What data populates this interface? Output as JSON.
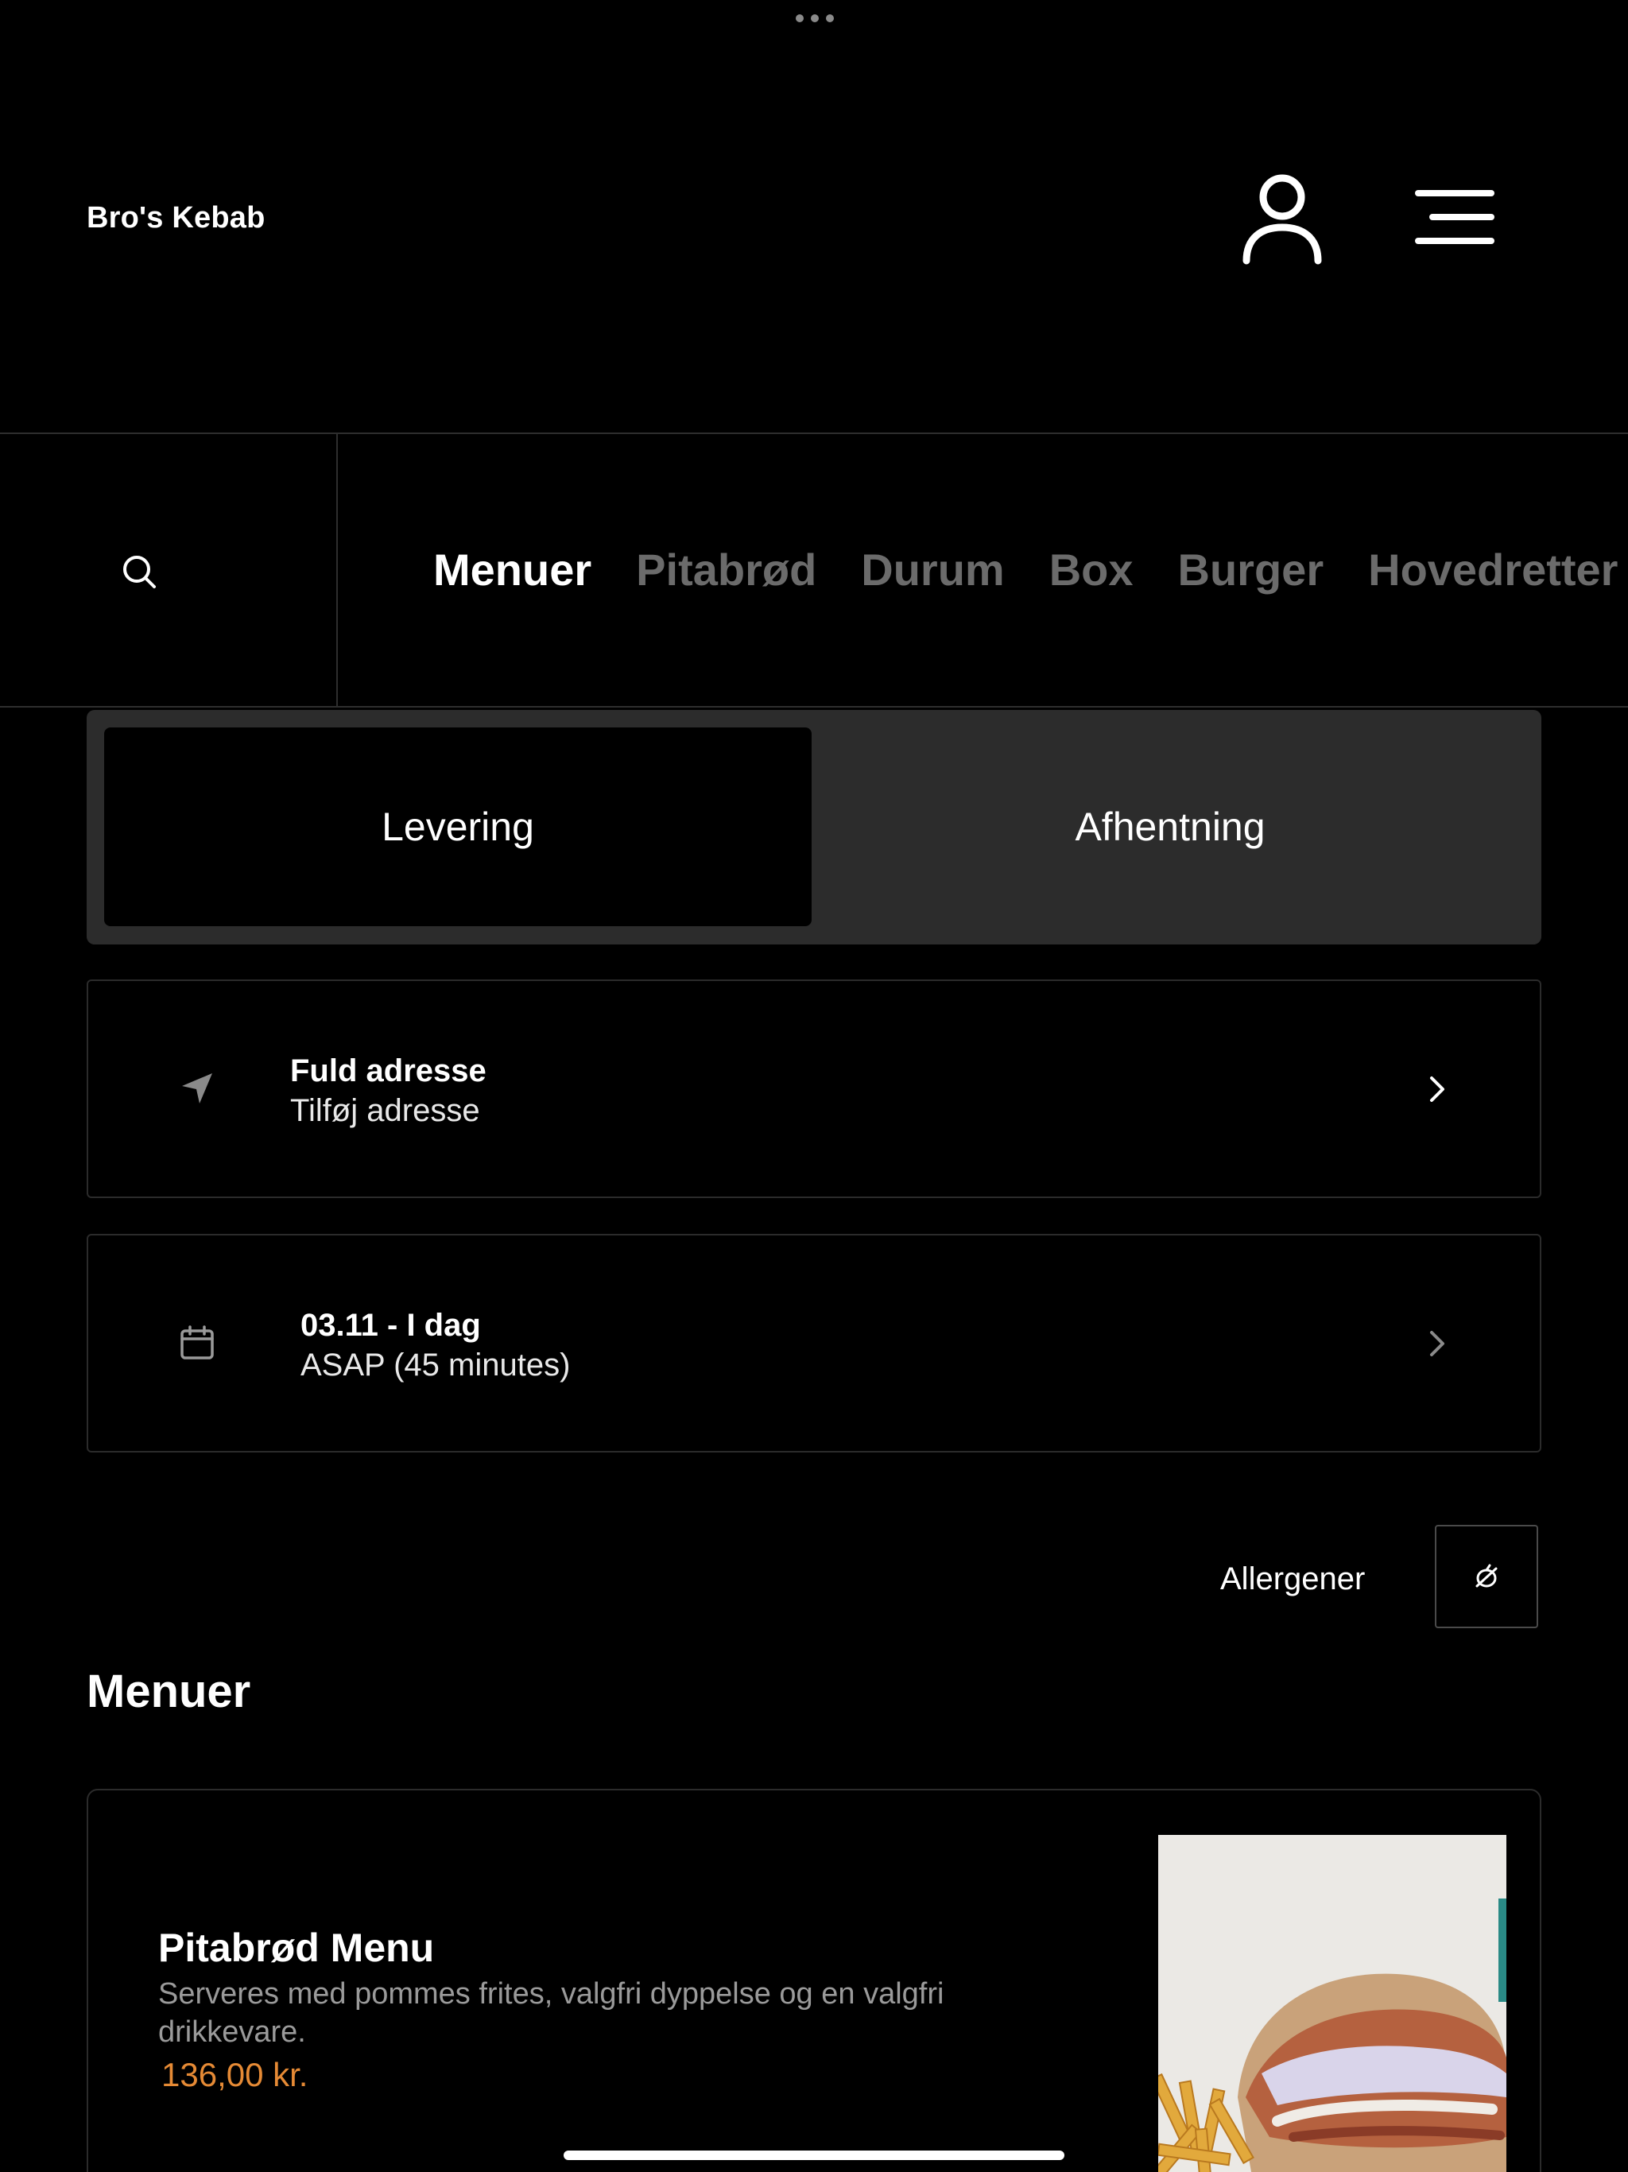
{
  "header": {
    "brand": "Bro's Kebab",
    "account_icon": "user-icon",
    "menu_icon": "hamburger-menu-icon"
  },
  "category_bar": {
    "search_icon": "search-icon",
    "tabs": [
      {
        "label": "Menuer",
        "active": true
      },
      {
        "label": "Pitabrød",
        "active": false
      },
      {
        "label": "Durum",
        "active": false
      },
      {
        "label": "Box",
        "active": false
      },
      {
        "label": "Burger",
        "active": false
      },
      {
        "label": "Hovedretter",
        "active": false
      }
    ]
  },
  "order_mode": {
    "options": [
      "Levering",
      "Afhentning"
    ],
    "selected": "Levering"
  },
  "address": {
    "title": "Fuld adresse",
    "subtitle": "Tilføj adresse",
    "icon": "location-arrow-icon"
  },
  "schedule": {
    "title": "03.11 - I dag",
    "subtitle": "ASAP (45 minutes)",
    "icon": "calendar-icon"
  },
  "allergens": {
    "label": "Allergener",
    "icon": "allergen-filter-icon"
  },
  "section": {
    "title": "Menuer"
  },
  "products": [
    {
      "name": "Pitabrød Menu",
      "description": "Serveres med pommes frites, valgfri dyppelse og en valgfri drikkevare.",
      "price": "136,00 kr."
    }
  ],
  "colors": {
    "background": "#000000",
    "inactive_tab": "#6b6b6b",
    "toggle_bg": "#2c2c2c",
    "border": "#2b2b2b",
    "price": "#e58a35",
    "muted_text": "#9a9a9a"
  }
}
